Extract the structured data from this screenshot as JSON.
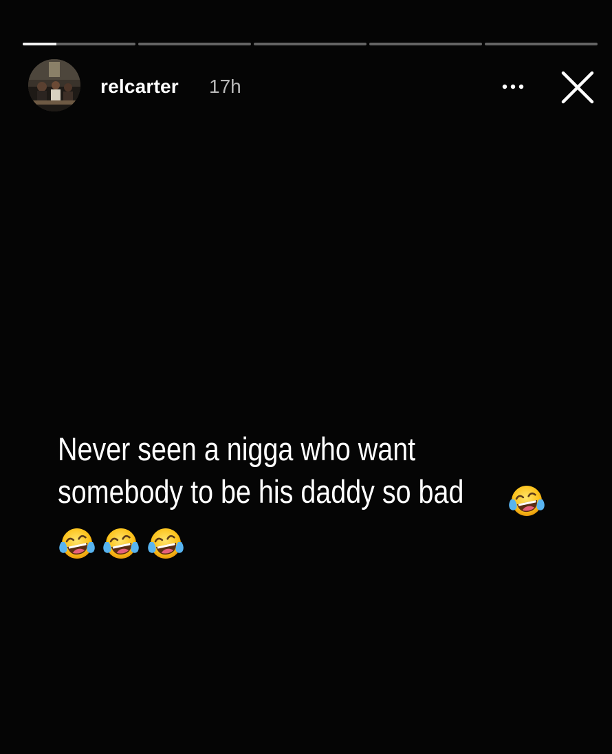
{
  "story": {
    "progress": [
      0.3,
      0,
      0,
      0,
      0
    ],
    "user": {
      "username": "relcarter",
      "time_ago": "17h"
    },
    "caption_lines": [
      "Never seen a nigga who want",
      "somebody to be his daddy so bad"
    ],
    "emoji_after_text": [
      "tears-of-joy",
      "tears-of-joy",
      "tears-of-joy",
      "tears-of-joy"
    ]
  },
  "colors": {
    "background": "#000000",
    "text": "#ffffff",
    "progress_track": "rgba(255,255,255,0.38)",
    "progress_fill": "#f2f2f2"
  },
  "icons": {
    "more": "more-horizontal-icon",
    "close": "close-icon",
    "emoji": "face-with-tears-of-joy-emoji"
  }
}
